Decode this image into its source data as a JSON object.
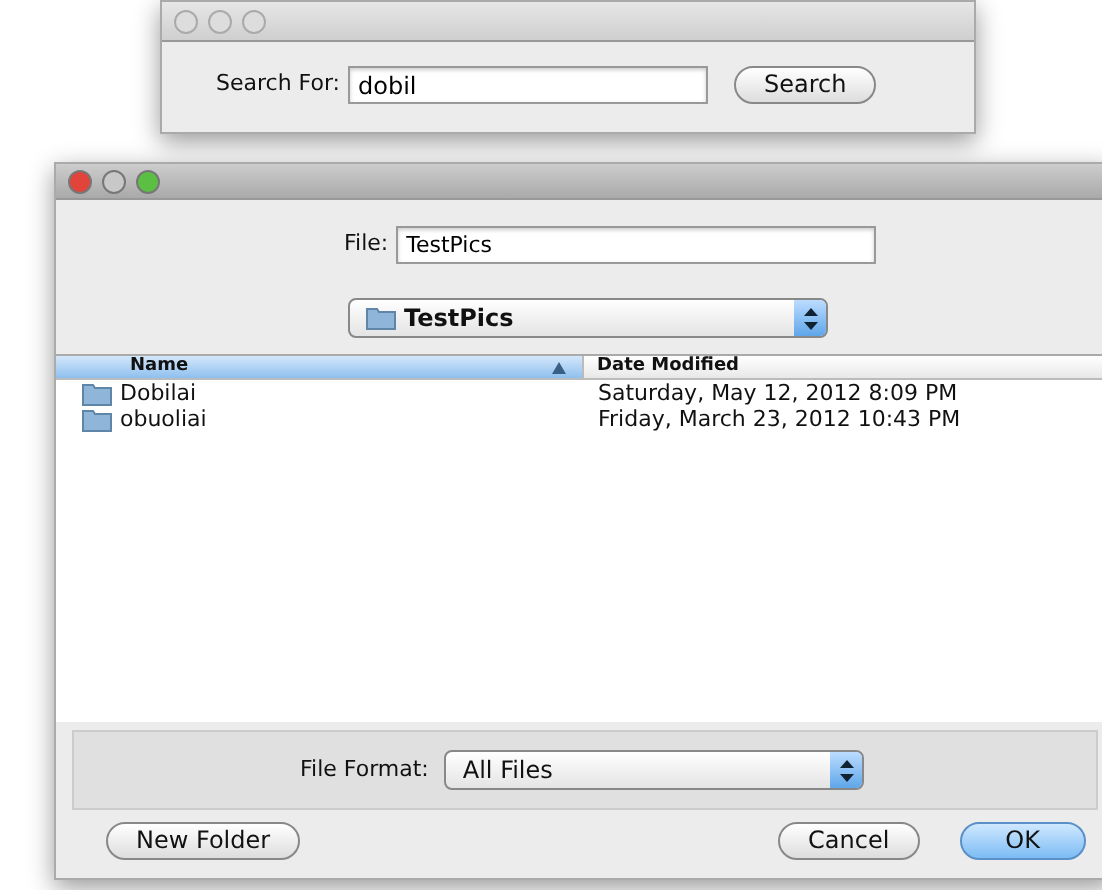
{
  "search_window": {
    "label": "Search For:",
    "value": "dobil",
    "button": "Search"
  },
  "dialog": {
    "file_label": "File:",
    "file_value": "TestPics",
    "folder": "TestPics",
    "columns": [
      {
        "label": "Name",
        "sorted": true
      },
      {
        "label": "Date Modified",
        "sorted": false
      }
    ],
    "rows": [
      {
        "name": "Dobilai",
        "date": "Saturday, May 12, 2012 8:09 PM",
        "selected": false
      },
      {
        "name": "obuoliai",
        "date": "Friday, March 23, 2012 10:43 PM",
        "selected": false
      }
    ],
    "format_label": "File Format:",
    "format_value": "All Files",
    "buttons": [
      {
        "label": "New Folder",
        "kind": "left",
        "default": false
      },
      {
        "label": "Cancel",
        "kind": "right",
        "default": false
      },
      {
        "label": "OK",
        "kind": "right",
        "default": true
      }
    ]
  }
}
